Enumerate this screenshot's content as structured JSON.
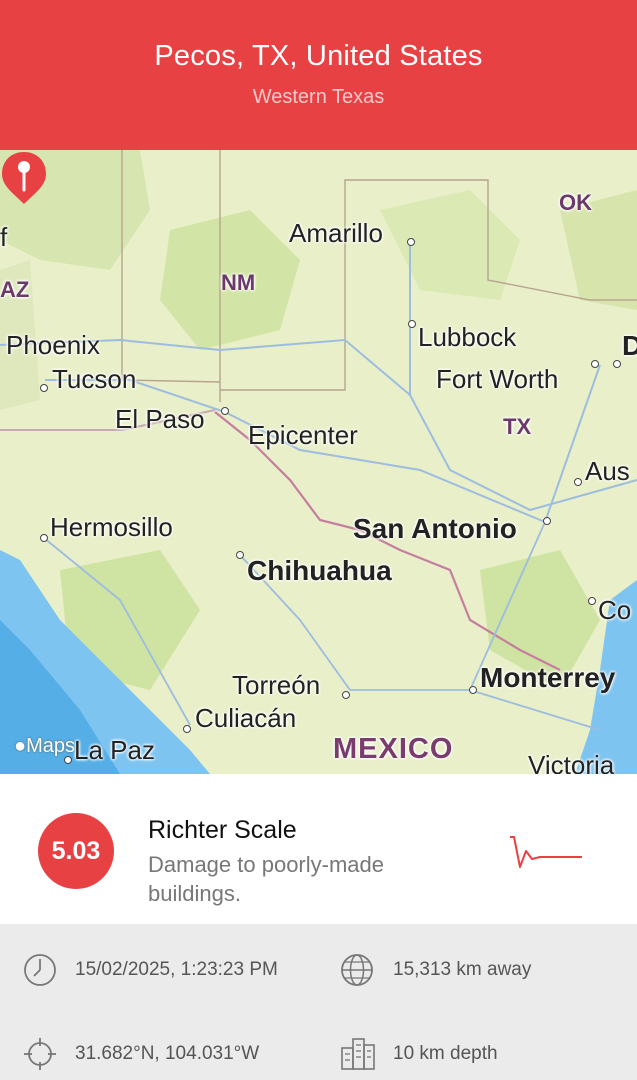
{
  "header": {
    "title": "Pecos, TX, United States",
    "subtitle": "Western Texas"
  },
  "map": {
    "labels": {
      "amarillo": "Amarillo",
      "ok": "OK",
      "f": "f",
      "az": "AZ",
      "nm": "NM",
      "phoenix": "Phoenix",
      "tucson": "Tucson",
      "lubbock": "Lubbock",
      "fort_worth": "Fort Worth",
      "d": "D",
      "el_paso": "El Paso",
      "epicenter": "Epicenter",
      "tx": "TX",
      "austin": "Aus",
      "hermosillo": "Hermosillo",
      "san_antonio": "San Antonio",
      "chihuahua": "Chihuahua",
      "co": "Co",
      "monterrey": "Monterrey",
      "torreon": "Torreón",
      "culiacan": "Culiacán",
      "la_paz": "La Paz",
      "mexico": "MEXICO",
      "victoria": "Victoria",
      "maps_logo": "Maps"
    },
    "colors": {
      "land": "#e9efc8",
      "water": "#7ec4f0",
      "park": "#cfe3a3",
      "road": "#9dbde0"
    }
  },
  "quake": {
    "magnitude": "5.03",
    "scale_title": "Richter Scale",
    "scale_description": "Damage to poorly-made buildings."
  },
  "details": {
    "datetime": "15/02/2025, 1:23:23 PM",
    "distance": "15,313 km away",
    "coordinates": "31.682°N, 104.031°W",
    "depth": "10 km depth"
  },
  "icons": {
    "time": "clock-icon",
    "distance": "globe-icon",
    "coordinates": "crosshair-icon",
    "depth": "buildings-icon",
    "scale": "seismograph-icon",
    "pin": "map-pin-icon"
  },
  "theme": {
    "accent": "#e84144",
    "details_background": "#ebebeb"
  }
}
